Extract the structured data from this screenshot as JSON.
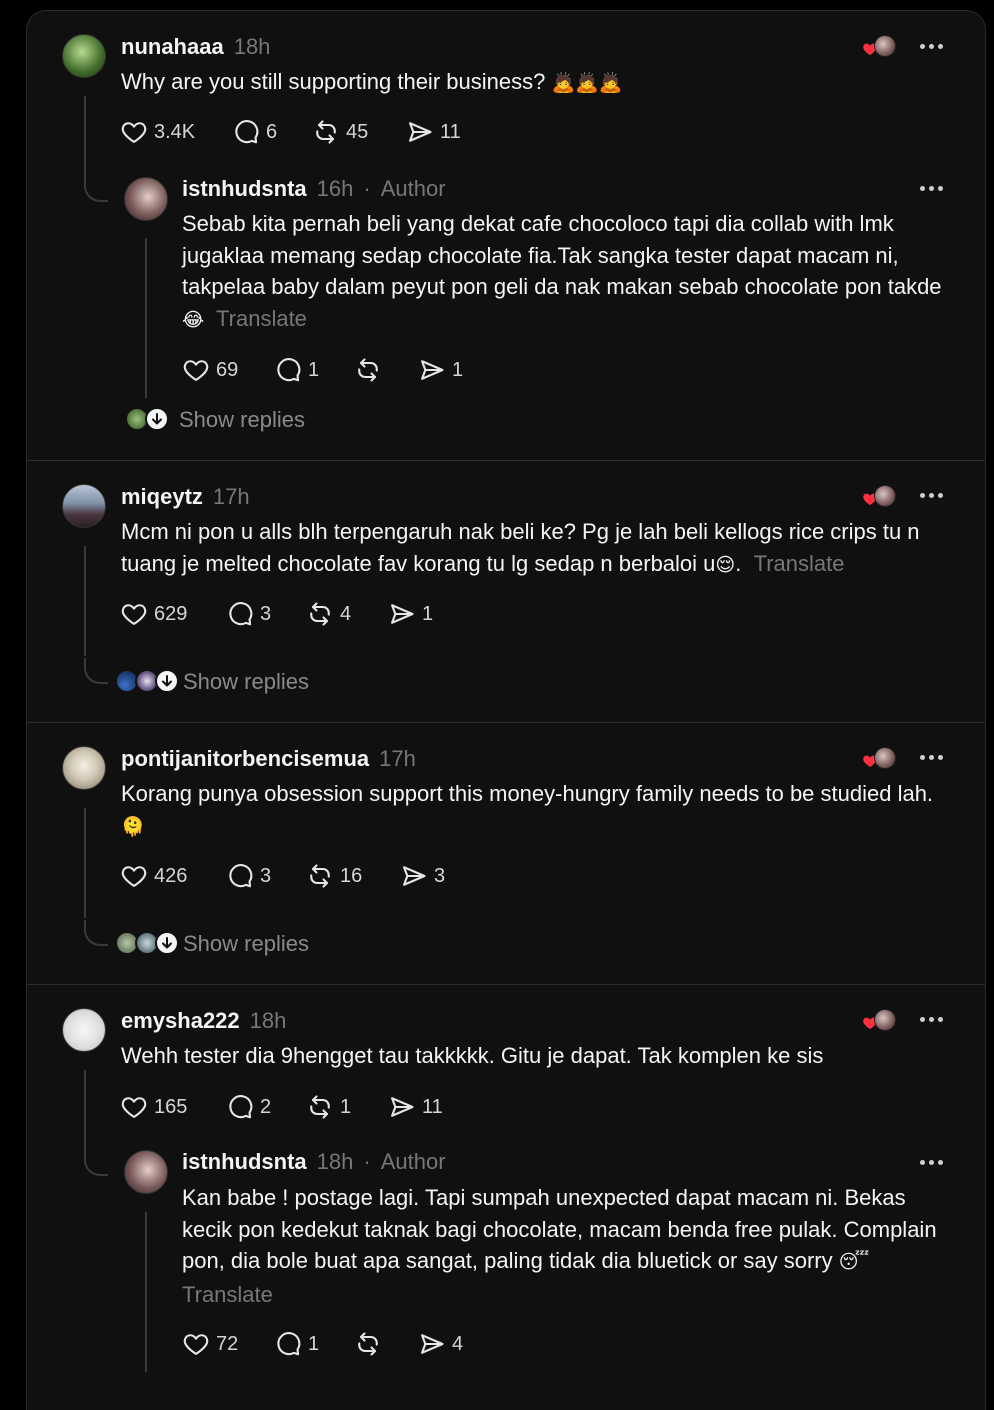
{
  "replies": [
    {
      "username": "nunahaaa",
      "time": "18h",
      "text": "Why are you still supporting their business?",
      "emoji": "🙇🙇🙇",
      "stats": {
        "likes": "3.4K",
        "comments": "6",
        "reposts": "45",
        "shares": "11"
      }
    },
    {
      "username": "istnhudsnta",
      "time": "16h",
      "author_label": "Author",
      "text": "Sebab kita pernah beli yang dekat cafe chocoloco tapi dia collab with lmk jugaklaa memang sedap chocolate fia.Tak sangka tester dapat macam ni, takpelaa baby dalam peyut pon geli da nak makan sebab chocolate pon takde",
      "emoji": "😂",
      "translate": "Translate",
      "stats": {
        "likes": "69",
        "comments": "1",
        "reposts": "",
        "shares": "1"
      },
      "show_replies": "Show replies"
    },
    {
      "username": "miqeytz",
      "time": "17h",
      "text": "Mcm ni pon u alls blh terpengaruh nak beli ke? Pg je lah beli kellogs rice crips tu n tuang je melted chocolate fav korang tu lg sedap n berbaloi u",
      "emoji": "😌",
      "after_emoji": ".",
      "translate": "Translate",
      "stats": {
        "likes": "629",
        "comments": "3",
        "reposts": "4",
        "shares": "1"
      },
      "show_replies": "Show replies"
    },
    {
      "username": "pontijanitorbencisemua",
      "time": "17h",
      "text": "Korang punya obsession support this money-hungry family needs to be studied lah.",
      "emoji": "🫠",
      "stats": {
        "likes": "426",
        "comments": "3",
        "reposts": "16",
        "shares": "3"
      },
      "show_replies": "Show replies"
    },
    {
      "username": "emysha222",
      "time": "18h",
      "text": "Wehh tester dia 9hengget tau takkkkk. Gitu je dapat. Tak komplen ke sis",
      "stats": {
        "likes": "165",
        "comments": "2",
        "reposts": "1",
        "shares": "11"
      }
    },
    {
      "username": "istnhudsnta",
      "time": "18h",
      "author_label": "Author",
      "text": "Kan babe ! postage lagi. Tapi sumpah unexpected dapat macam ni. Bekas kecik pon kedekut taknak bagi chocolate, macam benda free pulak. Complain pon, dia bole buat apa sangat, paling tidak dia bluetick or say sorry",
      "emoji": "😴",
      "translate": "Translate",
      "stats": {
        "likes": "72",
        "comments": "1",
        "reposts": "",
        "shares": "4"
      }
    }
  ],
  "colors": {
    "background": "#101010",
    "text_primary": "#f3f5f7",
    "text_secondary": "#777777",
    "heart_red": "#ff3040"
  },
  "icons": [
    "heart-icon",
    "comment-icon",
    "repost-icon",
    "share-icon",
    "more-icon",
    "show-replies-arrow-icon"
  ]
}
